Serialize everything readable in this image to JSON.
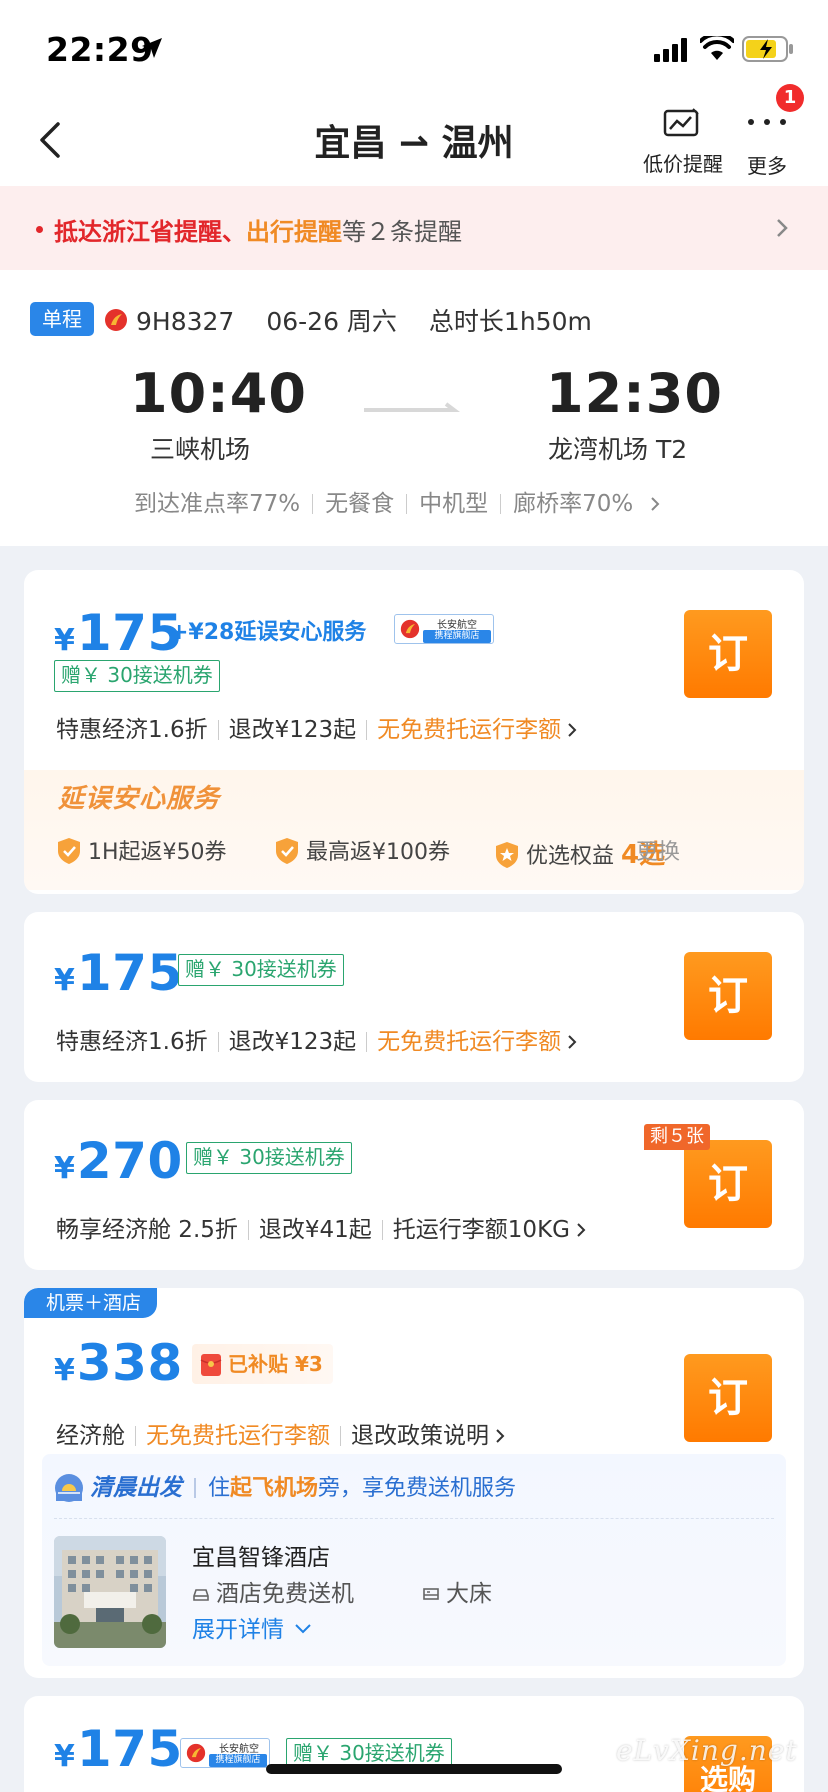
{
  "status_bar": {
    "time": "22:29"
  },
  "nav": {
    "title": "宜昌 ⇀ 温州",
    "price_alert_label": "低价提醒",
    "more_label": "更多",
    "badge": "1"
  },
  "notice": {
    "red_text": "抵达浙江省提醒、",
    "orange_text": "出行提醒",
    "rest_text": "等２条提醒"
  },
  "flight": {
    "trip_type": "单程",
    "flight_no": "9H8327",
    "date": "06-26 周六",
    "duration": "总时长1h50m",
    "dep_time": "10:40",
    "dep_airport": "三峡机场",
    "arr_time": "12:30",
    "arr_airport": "龙湾机场 T2",
    "stats": [
      "到达准点率77%",
      "无餐食",
      "中机型",
      "廊桥率70%"
    ]
  },
  "offers": [
    {
      "yen": "¥",
      "price": "175",
      "delay_service": "+¥28延误安心服务",
      "airline_flag_name": "长安航空",
      "airline_flag_sub": "携程旗舰店",
      "coupon": "赠￥ 30接送机券",
      "cabin": "特惠经济1.6折",
      "refund": "退改¥123起",
      "baggage": "无免费托运行李额",
      "book_label": "订",
      "delay_title": "延误安心服务",
      "delay_items": [
        "1H起返¥50券",
        "最高返¥100券",
        "优选权益"
      ],
      "delay_choice": "4选",
      "change_label": "更换"
    },
    {
      "yen": "¥",
      "price": "175",
      "coupon": "赠￥ 30接送机券",
      "cabin": "特惠经济1.6折",
      "refund": "退改¥123起",
      "baggage": "无免费托运行李额",
      "book_label": "订"
    },
    {
      "yen": "¥",
      "price": "270",
      "coupon": "赠￥ 30接送机券",
      "cabin": "畅享经济舱 2.5折",
      "refund": "退改¥41起",
      "baggage": "托运行李额10KG",
      "remain": "剩５张",
      "book_label": "订"
    },
    {
      "combo_tag": "机票＋酒店",
      "yen": "¥",
      "price": "338",
      "subsidy": "已补贴 ¥3",
      "cabin": "经济舱",
      "baggage": "无免费托运行李额",
      "policy": "退改政策说明",
      "book_label": "订",
      "early_title": "清晨出发",
      "early_desc_pre": "住",
      "early_desc_hl": "起飞机场",
      "early_desc_post": "旁，享免费送机服务",
      "hotel_name": "宜昌智锋酒店",
      "hotel_feature_1": "酒店免费送机",
      "hotel_feature_2": "大床",
      "expand_label": "展开详情"
    },
    {
      "yen": "¥",
      "price": "175",
      "airline_flag_name": "长安航空",
      "airline_flag_sub": "携程旗舰店",
      "coupon": "赠￥ 30接送机券",
      "book_label": "选购"
    }
  ],
  "watermark": "eLvXing.net",
  "colors": {
    "price_blue": "#1f82e6",
    "book_orange": "#ff8a0f",
    "coupon_green": "#2aa56f",
    "alert_red": "#e2272b"
  }
}
